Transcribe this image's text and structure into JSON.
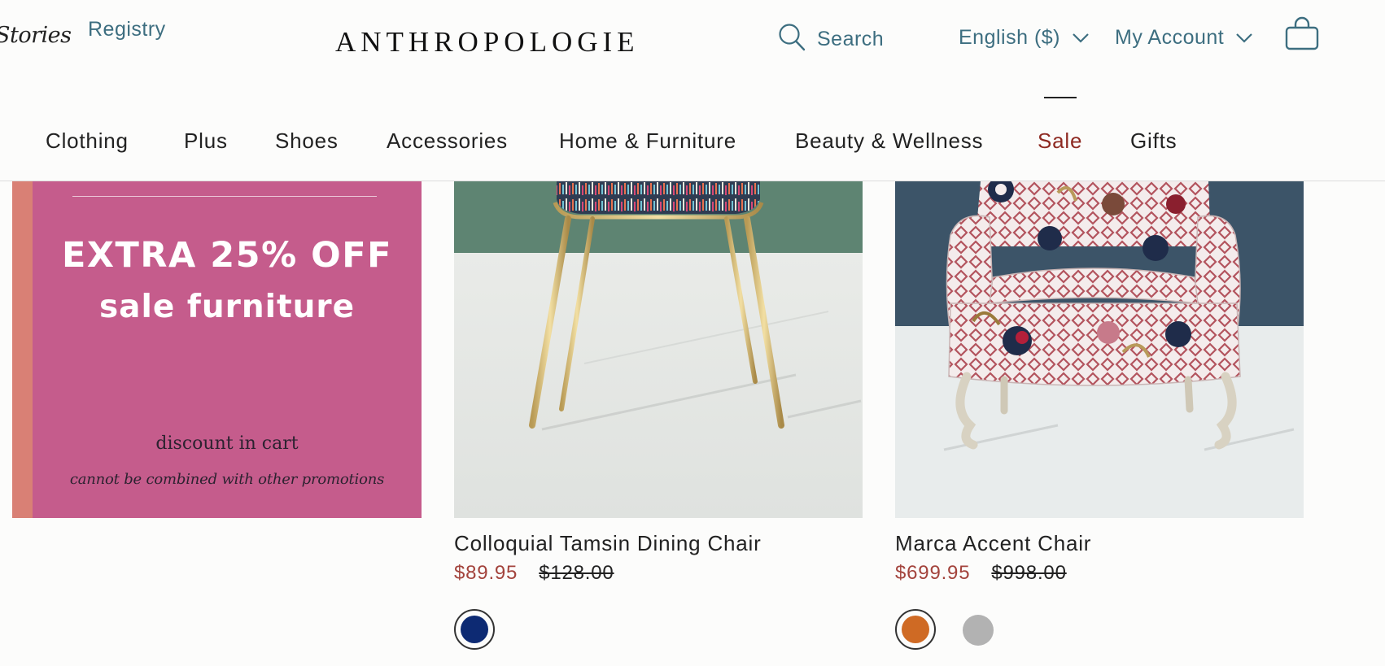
{
  "header": {
    "stories_link": "Stories",
    "registry_link": "Registry",
    "brand": "ANTHROPOLOGIE",
    "search_label": "Search",
    "language_label": "English ($)",
    "account_label": "My Account"
  },
  "nav": {
    "items": [
      {
        "label": "Clothing"
      },
      {
        "label": "Plus"
      },
      {
        "label": "Shoes"
      },
      {
        "label": "Accessories"
      },
      {
        "label": "Home & Furniture"
      },
      {
        "label": "Beauty & Wellness"
      },
      {
        "label": "Sale",
        "active": true
      },
      {
        "label": "Gifts"
      }
    ]
  },
  "promo": {
    "headline": "EXTRA 25% OFF",
    "subline": "sale furniture",
    "note": "discount in cart",
    "fineprint": "cannot be combined with other promotions",
    "background_color": "#c55c8c",
    "accent_color": "#d98075"
  },
  "products": [
    {
      "name": "Colloquial Tamsin Dining Chair",
      "sale_price": "$89.95",
      "original_price": "$128.00",
      "swatches": [
        {
          "color": "#0d2a73",
          "selected": true
        }
      ]
    },
    {
      "name": "Marca Accent Chair",
      "sale_price": "$699.95",
      "original_price": "$998.00",
      "swatches": [
        {
          "color": "#cf6a24",
          "selected": true
        },
        {
          "color": "#b2b2b2",
          "selected": false
        }
      ]
    }
  ],
  "colors": {
    "link_teal": "#3d6e80",
    "sale_red": "#8e2a22",
    "price_red": "#a3433c"
  },
  "icons": [
    "search-icon",
    "chevron-down-icon",
    "shopping-bag-icon"
  ]
}
